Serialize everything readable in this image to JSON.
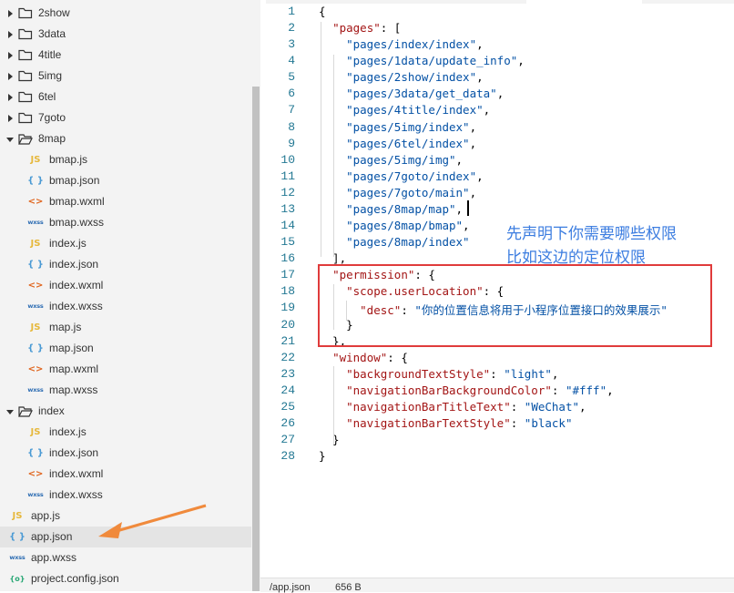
{
  "sidebar": {
    "items": [
      {
        "type": "folder",
        "label": "2show",
        "expanded": false,
        "indent": 0
      },
      {
        "type": "folder",
        "label": "3data",
        "expanded": false,
        "indent": 0
      },
      {
        "type": "folder",
        "label": "4title",
        "expanded": false,
        "indent": 0
      },
      {
        "type": "folder",
        "label": "5img",
        "expanded": false,
        "indent": 0
      },
      {
        "type": "folder",
        "label": "6tel",
        "expanded": false,
        "indent": 0
      },
      {
        "type": "folder",
        "label": "7goto",
        "expanded": false,
        "indent": 0
      },
      {
        "type": "folder",
        "label": "8map",
        "expanded": true,
        "indent": 0
      },
      {
        "type": "js",
        "label": "bmap.js",
        "indent": 1
      },
      {
        "type": "json",
        "label": "bmap.json",
        "indent": 1
      },
      {
        "type": "wxml",
        "label": "bmap.wxml",
        "indent": 1
      },
      {
        "type": "wxss",
        "label": "bmap.wxss",
        "indent": 1
      },
      {
        "type": "js",
        "label": "index.js",
        "indent": 1
      },
      {
        "type": "json",
        "label": "index.json",
        "indent": 1
      },
      {
        "type": "wxml",
        "label": "index.wxml",
        "indent": 1
      },
      {
        "type": "wxss",
        "label": "index.wxss",
        "indent": 1
      },
      {
        "type": "js",
        "label": "map.js",
        "indent": 1
      },
      {
        "type": "json",
        "label": "map.json",
        "indent": 1
      },
      {
        "type": "wxml",
        "label": "map.wxml",
        "indent": 1
      },
      {
        "type": "wxss",
        "label": "map.wxss",
        "indent": 1
      },
      {
        "type": "folder",
        "label": "index",
        "expanded": true,
        "indent": 0
      },
      {
        "type": "js",
        "label": "index.js",
        "indent": 1
      },
      {
        "type": "json",
        "label": "index.json",
        "indent": 1
      },
      {
        "type": "wxml",
        "label": "index.wxml",
        "indent": 1
      },
      {
        "type": "wxss",
        "label": "index.wxss",
        "indent": 1
      },
      {
        "type": "js",
        "label": "app.js",
        "indent": -1
      },
      {
        "type": "json",
        "label": "app.json",
        "indent": -1,
        "selected": true
      },
      {
        "type": "wxss",
        "label": "app.wxss",
        "indent": -1
      },
      {
        "type": "cfg",
        "label": "project.config.json",
        "indent": -1
      }
    ],
    "icons": {
      "js": "JS",
      "json": "{ }",
      "wxml": "<>",
      "wxss": "wxss",
      "cfg": "{o}"
    }
  },
  "editor": {
    "lines": [
      [
        [
          "p",
          "{"
        ]
      ],
      [
        [
          "p",
          "  "
        ],
        [
          "k",
          "\"pages\""
        ],
        [
          "p",
          ": ["
        ]
      ],
      [
        [
          "p",
          "    "
        ],
        [
          "s",
          "\"pages/index/index\""
        ],
        [
          "p",
          ","
        ]
      ],
      [
        [
          "p",
          "    "
        ],
        [
          "s",
          "\"pages/1data/update_info\""
        ],
        [
          "p",
          ","
        ]
      ],
      [
        [
          "p",
          "    "
        ],
        [
          "s",
          "\"pages/2show/index\""
        ],
        [
          "p",
          ","
        ]
      ],
      [
        [
          "p",
          "    "
        ],
        [
          "s",
          "\"pages/3data/get_data\""
        ],
        [
          "p",
          ","
        ]
      ],
      [
        [
          "p",
          "    "
        ],
        [
          "s",
          "\"pages/4title/index\""
        ],
        [
          "p",
          ","
        ]
      ],
      [
        [
          "p",
          "    "
        ],
        [
          "s",
          "\"pages/5img/index\""
        ],
        [
          "p",
          ","
        ]
      ],
      [
        [
          "p",
          "    "
        ],
        [
          "s",
          "\"pages/6tel/index\""
        ],
        [
          "p",
          ","
        ]
      ],
      [
        [
          "p",
          "    "
        ],
        [
          "s",
          "\"pages/5img/img\""
        ],
        [
          "p",
          ","
        ]
      ],
      [
        [
          "p",
          "    "
        ],
        [
          "s",
          "\"pages/7goto/index\""
        ],
        [
          "p",
          ","
        ]
      ],
      [
        [
          "p",
          "    "
        ],
        [
          "s",
          "\"pages/7goto/main\""
        ],
        [
          "p",
          ","
        ]
      ],
      [
        [
          "p",
          "    "
        ],
        [
          "s",
          "\"pages/8map/map\""
        ],
        [
          "p",
          ","
        ]
      ],
      [
        [
          "p",
          "    "
        ],
        [
          "s",
          "\"pages/8map/bmap\""
        ],
        [
          "p",
          ","
        ]
      ],
      [
        [
          "p",
          "    "
        ],
        [
          "s",
          "\"pages/8map/index\""
        ]
      ],
      [
        [
          "p",
          "  ],"
        ]
      ],
      [
        [
          "p",
          "  "
        ],
        [
          "k",
          "\"permission\""
        ],
        [
          "p",
          ": {"
        ]
      ],
      [
        [
          "p",
          "    "
        ],
        [
          "k",
          "\"scope.userLocation\""
        ],
        [
          "p",
          ": {"
        ]
      ],
      [
        [
          "p",
          "      "
        ],
        [
          "k",
          "\"desc\""
        ],
        [
          "p",
          ": "
        ],
        [
          "s",
          "\"你的位置信息将用于小程序位置接口的效果展示\""
        ]
      ],
      [
        [
          "p",
          "    }"
        ]
      ],
      [
        [
          "p",
          "  },"
        ]
      ],
      [
        [
          "p",
          "  "
        ],
        [
          "k",
          "\"window\""
        ],
        [
          "p",
          ": {"
        ]
      ],
      [
        [
          "p",
          "    "
        ],
        [
          "k",
          "\"backgroundTextStyle\""
        ],
        [
          "p",
          ": "
        ],
        [
          "s",
          "\"light\""
        ],
        [
          "p",
          ","
        ]
      ],
      [
        [
          "p",
          "    "
        ],
        [
          "k",
          "\"navigationBarBackgroundColor\""
        ],
        [
          "p",
          ": "
        ],
        [
          "s",
          "\"#fff\""
        ],
        [
          "p",
          ","
        ]
      ],
      [
        [
          "p",
          "    "
        ],
        [
          "k",
          "\"navigationBarTitleText\""
        ],
        [
          "p",
          ": "
        ],
        [
          "s",
          "\"WeChat\""
        ],
        [
          "p",
          ","
        ]
      ],
      [
        [
          "p",
          "    "
        ],
        [
          "k",
          "\"navigationBarTextStyle\""
        ],
        [
          "p",
          ": "
        ],
        [
          "s",
          "\"black\""
        ]
      ],
      [
        [
          "p",
          "  }"
        ]
      ],
      [
        [
          "p",
          "}"
        ]
      ]
    ]
  },
  "annotation": {
    "line1": "先声明下你需要哪些权限",
    "line2": "比如这边的定位权限"
  },
  "statusbar": {
    "path": "/app.json",
    "size": "656 B"
  },
  "colors": {
    "annotation": "#3c7de0",
    "highlight_box": "#e03b3b",
    "arrow": "#f08a3c"
  }
}
